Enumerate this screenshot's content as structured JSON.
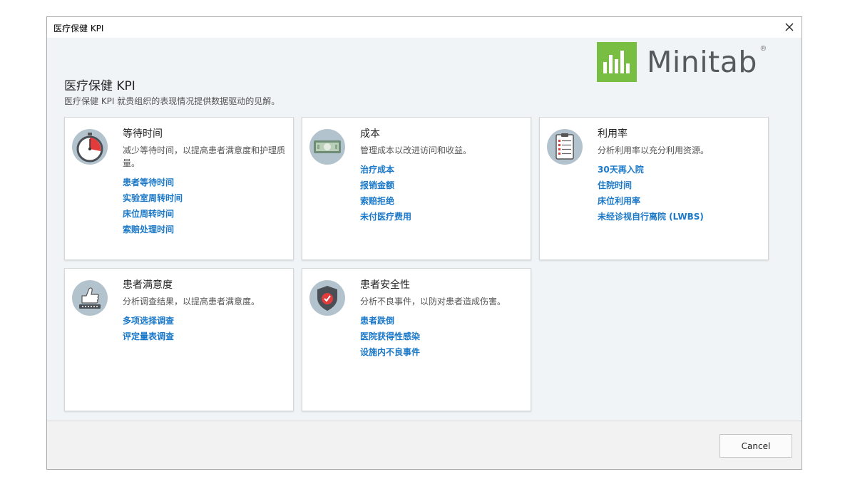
{
  "window": {
    "title": "医疗保健 KPI",
    "close_icon": "close-icon"
  },
  "brand": {
    "name": "Minitab",
    "registered": "®",
    "color": "#78be43"
  },
  "header": {
    "title": "医疗保健 KPI",
    "subtitle": "医疗保健 KPI 就贵组织的表现情况提供数据驱动的见解。"
  },
  "cards": [
    {
      "title": "等待时间",
      "icon": "stopwatch-icon",
      "description": "减少等待时间，以提高患者满意度和护理质量。",
      "links": [
        "患者等待时间",
        "实验室周转时间",
        "床位周转时间",
        "索赔处理时间"
      ]
    },
    {
      "title": "成本",
      "icon": "money-icon",
      "description": "管理成本以改进访问和收益。",
      "links": [
        "治疗成本",
        "报销金额",
        "索赔拒绝",
        "未付医疗费用"
      ]
    },
    {
      "title": "利用率",
      "icon": "clipboard-icon",
      "description": "分析利用率以充分利用资源。",
      "links": [
        "30天再入院",
        "住院时间",
        "床位利用率",
        "未经诊视自行离院 (LWBS)"
      ]
    },
    {
      "title": "患者满意度",
      "icon": "thumbs-up-icon",
      "description": "分析调查结果，以提高患者满意度。",
      "links": [
        "多项选择调查",
        "评定量表调查"
      ]
    },
    {
      "title": "患者安全性",
      "icon": "shield-icon",
      "description": "分析不良事件，以防对患者造成伤害。",
      "links": [
        "患者跌倒",
        "医院获得性感染",
        "设施内不良事件"
      ]
    }
  ],
  "footer": {
    "cancel_label": "Cancel"
  },
  "colors": {
    "link": "#1a78c8",
    "content_bg": "#f0f4f6",
    "icon_circle": "#b3c3cd"
  }
}
